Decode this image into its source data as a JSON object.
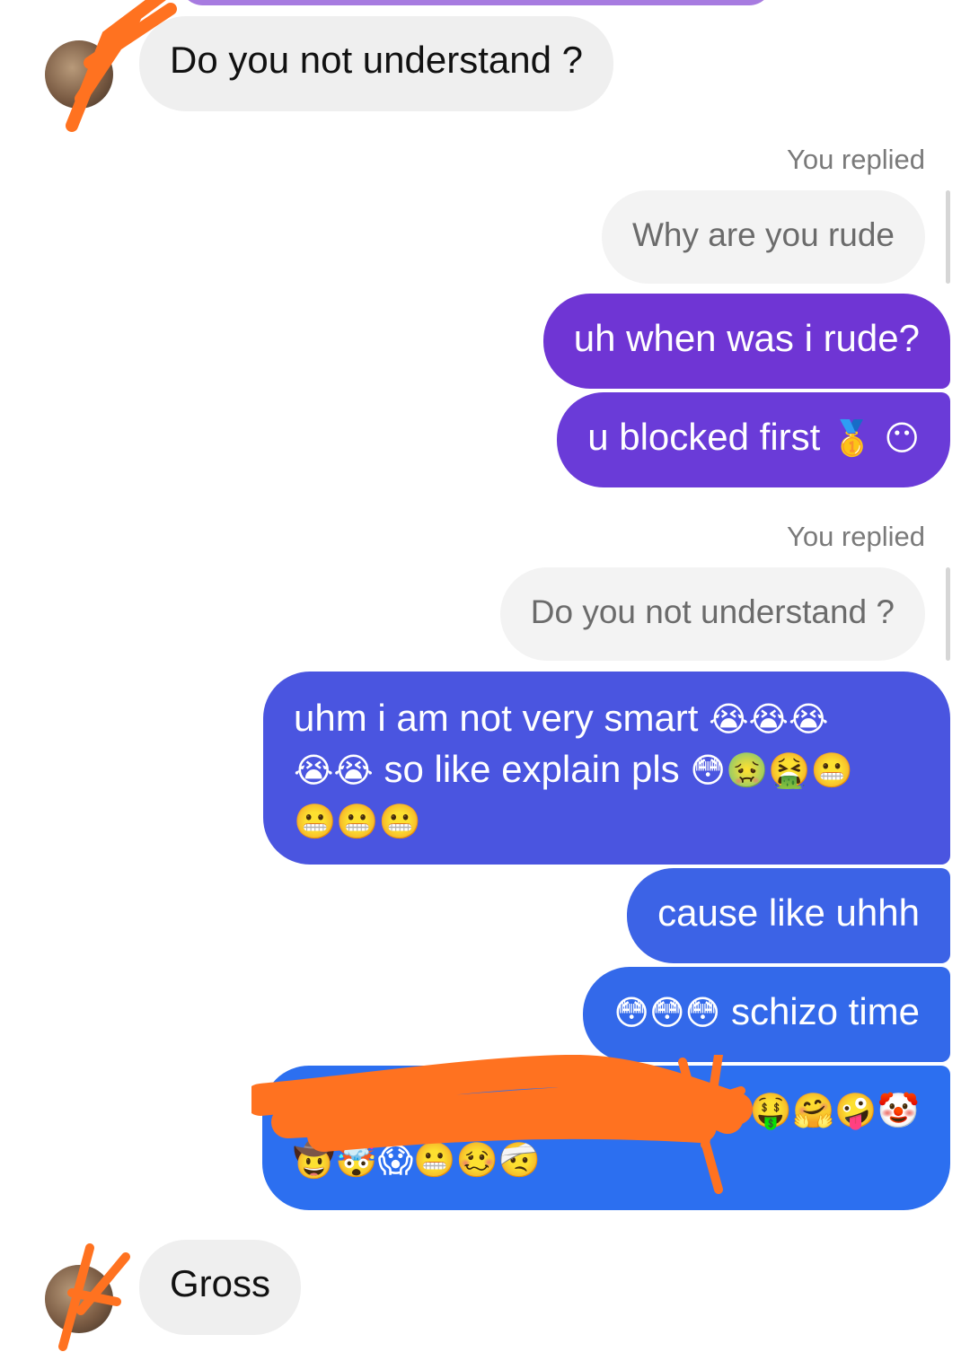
{
  "messages": {
    "in1": "Do you not understand ?",
    "reply_label_1": "You replied",
    "quote_1": "Why are you rude",
    "out1": "uh when was i rude?",
    "out2_text": "u blocked first",
    "out2_emoji": "🥇 😶",
    "reply_label_2": "You replied",
    "quote_2": "Do you not understand ?",
    "out3_text_a": "uhm i am not very smart",
    "out3_emoji_a": "😭😭😭",
    "out3_emoji_b": "😭😭",
    "out3_text_b": "so like explain pls",
    "out3_emoji_c": "😳🤢🤮😬",
    "out3_emoji_d": "😬😬😬",
    "out4": "cause like uhhh",
    "out5_emoji": "😳😳😳",
    "out5_text": "schizo time",
    "out6_emoji_a": "🤑🤗🤪🤡",
    "out6_emoji_b": "🤠🤯😱😬🥴🤕",
    "in2": "Gross"
  },
  "colors": {
    "bubble_purple": "#6e36d6",
    "bubble_indigo": "#4a55e0",
    "bubble_blue": "#2c6ff0",
    "scribble": "#ff7220"
  },
  "icons": {
    "avatar": "contact-avatar",
    "redaction": "orange-scribble"
  }
}
